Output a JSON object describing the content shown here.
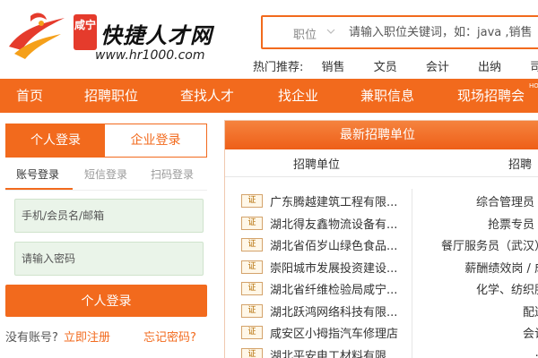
{
  "brand": {
    "badge": "咸宁",
    "name": "快捷人才网",
    "url": "www.hr1000.com"
  },
  "search": {
    "type_label": "职位",
    "placeholder": "请输入职位关键词，如：java ,销售"
  },
  "hot": {
    "label": "热门推荐:",
    "links": [
      "销售",
      "文员",
      "会计",
      "出纳",
      "司机"
    ]
  },
  "nav": {
    "items": [
      "首页",
      "招聘职位",
      "查找人才",
      "找企业",
      "兼职信息",
      "现场招聘会"
    ],
    "sup": "HOT"
  },
  "login": {
    "tab_personal": "个人登录",
    "tab_company": "企业登录",
    "sub_tabs": [
      "账号登录",
      "短信登录",
      "扫码登录"
    ],
    "username_placeholder": "手机/会员名/邮箱",
    "password_placeholder": "请输入密码",
    "submit_label": "个人登录",
    "no_account": "没有账号?",
    "register": "立即注册",
    "forgot": "忘记密码?"
  },
  "companies": {
    "title": "最新招聘单位",
    "col_company": "招聘单位",
    "col_jobs": "招聘",
    "cert_label": "证",
    "rows": [
      {
        "name": "广东腾越建筑工程有限...",
        "job": "综合管理员（"
      },
      {
        "name": "湖北得友鑫物流设备有...",
        "job": "抢票专员（"
      },
      {
        "name": "湖北省佰岁山绿色食品...",
        "job": "餐厅服务员（武汉）"
      },
      {
        "name": "崇阳城市发展投资建设...",
        "job": "薪酬绩效岗 / 成"
      },
      {
        "name": "湖北省纤维检验局咸宁...",
        "job": "化学、纺织服"
      },
      {
        "name": "湖北跃鸿网络科技有限...",
        "job": "配送"
      },
      {
        "name": "咸安区小拇指汽车修理店",
        "job": "会计"
      },
      {
        "name": "湖北平安电工材料有限...",
        "job": "..."
      }
    ]
  },
  "colors": {
    "accent": "#f26a1d",
    "field_bg": "#eaf4e9"
  }
}
